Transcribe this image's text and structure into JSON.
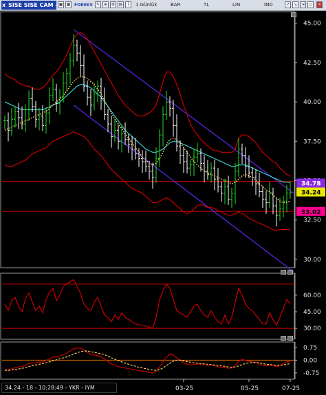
{
  "toolbar": {
    "symbol": "SISE SISE CAM -",
    "close_glyph": "x",
    "brand": "FOREKS",
    "period": "1 Günlük",
    "chart_type": "BAR",
    "currency": "TL",
    "scale": "LIN",
    "indicators": "IND"
  },
  "status_bar": {
    "text": "34.24 - 18 - 10:28:49 - YKR - IYM"
  },
  "colors": {
    "background": "#000000",
    "price_up": "#22dd22",
    "price_down": "#ffffff",
    "bollinger": "#cc0000",
    "moving_average": "#33cccc",
    "dotted_ma": "#ffcc66",
    "channel": "#5522cc",
    "level_line": "#cc0000",
    "label_high": "#8a2be2",
    "label_last": "#e8e800",
    "label_low": "#ff0090",
    "axis_text": "#e0e0e0"
  },
  "chart_data": [
    {
      "type": "line",
      "panel": "price",
      "yticks": [
        "45.00",
        "42.50",
        "40.00",
        "37.50",
        "35.00",
        "32.50",
        "30.00"
      ],
      "ylim": [
        29.6,
        45.6
      ],
      "xticks": [
        "03-25",
        "05-25",
        "07-25"
      ],
      "price_labels": {
        "high": "34.78",
        "last": "34.24",
        "low": "33.02"
      },
      "levels": [
        34.95,
        33.05
      ],
      "channel_lines": [
        {
          "x": [
            20,
            84
          ],
          "y": [
            44.6,
            34.2
          ]
        },
        {
          "x": [
            20,
            84
          ],
          "y": [
            39.8,
            29.2
          ]
        }
      ],
      "series": [
        {
          "key": "price",
          "close": [
            38.8,
            38.2,
            38.9,
            39.4,
            39.0,
            38.6,
            39.5,
            40.2,
            39.7,
            38.9,
            39.1,
            38.5,
            39.3,
            40.4,
            40.8,
            39.9,
            40.3,
            41.2,
            41.8,
            42.6,
            43.6,
            43.1,
            42.3,
            41.0,
            40.3,
            39.8,
            40.5,
            41.0,
            40.2,
            39.2,
            38.6,
            37.8,
            38.2,
            37.5,
            38.0,
            37.6,
            37.3,
            37.0,
            36.7,
            36.4,
            36.2,
            35.9,
            35.6,
            35.2,
            36.4,
            37.9,
            39.2,
            40.0,
            39.6,
            38.5,
            37.2,
            36.6,
            36.2,
            35.8,
            36.0,
            36.5,
            36.7,
            36.1,
            35.6,
            35.4,
            35.8,
            35.1,
            34.6,
            34.2,
            34.6,
            33.8,
            34.2,
            35.6,
            37.0,
            36.6,
            35.9,
            35.5,
            35.2,
            34.8,
            34.3,
            33.8,
            33.6,
            34.2,
            33.4,
            32.8,
            33.2,
            33.7,
            34.2,
            34.24
          ]
        },
        {
          "key": "bollinger_upper",
          "values": [
            41.8,
            41.6,
            41.5,
            41.4,
            41.2,
            41.1,
            41.0,
            41.0,
            40.9,
            40.8,
            40.8,
            40.9,
            41.1,
            41.4,
            41.7,
            41.9,
            42.2,
            42.6,
            43.0,
            43.5,
            44.0,
            44.3,
            44.4,
            44.3,
            44.0,
            43.6,
            43.2,
            42.8,
            42.4,
            42.0,
            41.6,
            41.2,
            40.8,
            40.4,
            40.1,
            39.8,
            39.6,
            39.4,
            39.2,
            39.1,
            39.1,
            39.2,
            39.3,
            39.5,
            39.8,
            40.5,
            41.3,
            41.9,
            41.9,
            41.6,
            41.1,
            40.5,
            39.8,
            39.2,
            38.6,
            38.2,
            37.9,
            37.6,
            37.4,
            37.2,
            37.0,
            36.9,
            36.9,
            36.8,
            36.8,
            36.8,
            36.8,
            37.0,
            37.7,
            37.9,
            37.9,
            37.8,
            37.6,
            37.4,
            37.1,
            36.8,
            36.6,
            36.4,
            36.2,
            36.1,
            35.8,
            35.6,
            35.4,
            35.3
          ]
        },
        {
          "key": "bollinger_lower",
          "values": [
            36.0,
            35.9,
            35.9,
            36.0,
            36.1,
            36.2,
            36.3,
            36.5,
            36.7,
            36.8,
            36.9,
            37.0,
            37.1,
            37.3,
            37.5,
            37.6,
            37.7,
            37.8,
            37.9,
            38.0,
            38.1,
            38.0,
            37.9,
            37.8,
            37.6,
            37.3,
            37.0,
            36.8,
            36.6,
            36.3,
            36.0,
            35.7,
            35.5,
            35.3,
            35.1,
            34.9,
            34.7,
            34.5,
            34.4,
            34.3,
            34.2,
            34.0,
            33.8,
            33.6,
            33.6,
            33.7,
            33.8,
            33.9,
            33.8,
            33.6,
            33.4,
            33.2,
            33.0,
            32.9,
            33.0,
            33.2,
            33.4,
            33.5,
            33.4,
            33.3,
            33.3,
            33.2,
            33.1,
            33.0,
            32.9,
            32.8,
            32.8,
            32.9,
            33.0,
            32.9,
            32.8,
            32.6,
            32.5,
            32.4,
            32.3,
            32.2,
            32.1,
            32.0,
            31.9,
            31.8,
            31.9,
            31.9,
            31.9,
            31.9
          ]
        },
        {
          "key": "ma_dotted",
          "values": [
            38.2,
            38.3,
            38.4,
            38.5,
            38.6,
            38.7,
            38.8,
            38.9,
            39.0,
            39.1,
            39.2,
            39.3,
            39.4,
            39.6,
            39.8,
            40.0,
            40.2,
            40.4,
            40.7,
            41.0,
            41.3,
            41.5,
            41.6,
            41.6,
            41.5,
            41.3,
            41.1,
            40.8,
            40.5,
            40.1,
            39.7,
            39.3,
            38.9,
            38.6,
            38.3,
            38.0,
            37.7,
            37.4,
            37.1,
            36.8,
            36.5,
            36.3,
            36.1,
            36.0,
            36.1,
            36.4,
            36.8,
            37.3,
            37.6,
            37.7,
            37.6,
            37.4,
            37.1,
            36.8,
            36.5,
            36.2,
            36.0,
            35.8,
            35.6,
            35.5,
            35.4,
            35.3,
            35.2,
            35.1,
            35.0,
            34.9,
            34.8,
            34.9,
            35.1,
            35.3,
            35.4,
            35.3,
            35.2,
            35.0,
            34.8,
            34.6,
            34.4,
            34.3,
            34.1,
            33.9,
            33.7,
            33.6,
            33.6,
            33.7
          ]
        },
        {
          "key": "ma_solid",
          "values": [
            40.0,
            39.9,
            39.8,
            39.7,
            39.6,
            39.5,
            39.5,
            39.5,
            39.5,
            39.5,
            39.5,
            39.5,
            39.6,
            39.7,
            39.8,
            39.9,
            40.0,
            40.2,
            40.4,
            40.6,
            40.8,
            41.0,
            41.1,
            41.1,
            41.0,
            40.9,
            40.7,
            40.5,
            40.3,
            40.0,
            39.7,
            39.4,
            39.1,
            38.8,
            38.5,
            38.2,
            38.0,
            37.8,
            37.6,
            37.4,
            37.2,
            37.0,
            36.9,
            36.8,
            36.8,
            36.9,
            37.0,
            37.2,
            37.4,
            37.5,
            37.5,
            37.4,
            37.3,
            37.2,
            37.1,
            37.0,
            36.9,
            36.8,
            36.7,
            36.6,
            36.5,
            36.4,
            36.3,
            36.2,
            36.1,
            36.0,
            35.9,
            35.9,
            36.0,
            36.0,
            36.0,
            35.9,
            35.8,
            35.7,
            35.6,
            35.5,
            35.4,
            35.3,
            35.2,
            35.1,
            35.0,
            34.9,
            34.9,
            34.9
          ]
        }
      ]
    },
    {
      "type": "line",
      "panel": "rsi",
      "yticks": [
        "60.00",
        "45.00",
        "30.00"
      ],
      "ylim": [
        22,
        78
      ],
      "levels": [
        70,
        30
      ],
      "series": [
        {
          "key": "rsi",
          "values": [
            52,
            46,
            55,
            58,
            50,
            45,
            57,
            62,
            54,
            46,
            50,
            44,
            56,
            63,
            66,
            55,
            60,
            68,
            70,
            72,
            74,
            68,
            62,
            52,
            48,
            46,
            54,
            58,
            50,
            42,
            40,
            36,
            42,
            38,
            44,
            40,
            38,
            36,
            34,
            33,
            33,
            32,
            31,
            30,
            40,
            56,
            64,
            70,
            66,
            56,
            46,
            44,
            42,
            40,
            45,
            50,
            52,
            46,
            42,
            40,
            46,
            40,
            36,
            34,
            42,
            34,
            40,
            54,
            66,
            60,
            52,
            48,
            46,
            42,
            38,
            34,
            34,
            44,
            38,
            33,
            40,
            48,
            56,
            52
          ]
        }
      ]
    },
    {
      "type": "line",
      "panel": "macd",
      "yticks": [
        "0.75",
        "0.00",
        "-0.75"
      ],
      "ylim": [
        -1.0,
        0.95
      ],
      "levels": [
        0.0
      ],
      "series": [
        {
          "key": "macd",
          "values": [
            -0.55,
            -0.58,
            -0.52,
            -0.44,
            -0.4,
            -0.38,
            -0.3,
            -0.2,
            -0.16,
            -0.16,
            -0.12,
            -0.1,
            -0.02,
            0.08,
            0.18,
            0.2,
            0.24,
            0.32,
            0.42,
            0.54,
            0.66,
            0.72,
            0.7,
            0.6,
            0.46,
            0.34,
            0.3,
            0.28,
            0.2,
            0.06,
            -0.08,
            -0.22,
            -0.3,
            -0.38,
            -0.42,
            -0.46,
            -0.5,
            -0.54,
            -0.58,
            -0.62,
            -0.64,
            -0.68,
            -0.72,
            -0.76,
            -0.66,
            -0.4,
            -0.1,
            0.2,
            0.34,
            0.3,
            0.14,
            -0.02,
            -0.14,
            -0.24,
            -0.28,
            -0.26,
            -0.22,
            -0.24,
            -0.28,
            -0.3,
            -0.28,
            -0.32,
            -0.38,
            -0.44,
            -0.42,
            -0.48,
            -0.46,
            -0.3,
            -0.06,
            0.04,
            0.0,
            -0.06,
            -0.1,
            -0.16,
            -0.22,
            -0.3,
            -0.34,
            -0.28,
            -0.32,
            -0.38,
            -0.32,
            -0.22,
            -0.1,
            -0.06
          ]
        },
        {
          "key": "signal",
          "values": [
            -0.6,
            -0.6,
            -0.58,
            -0.55,
            -0.52,
            -0.48,
            -0.44,
            -0.38,
            -0.32,
            -0.28,
            -0.24,
            -0.2,
            -0.16,
            -0.1,
            -0.04,
            0.02,
            0.08,
            0.14,
            0.2,
            0.28,
            0.36,
            0.44,
            0.5,
            0.54,
            0.54,
            0.5,
            0.46,
            0.42,
            0.38,
            0.32,
            0.24,
            0.14,
            0.06,
            -0.02,
            -0.1,
            -0.18,
            -0.24,
            -0.3,
            -0.36,
            -0.42,
            -0.46,
            -0.5,
            -0.54,
            -0.58,
            -0.6,
            -0.56,
            -0.46,
            -0.32,
            -0.18,
            -0.06,
            0.0,
            0.0,
            -0.04,
            -0.08,
            -0.12,
            -0.16,
            -0.18,
            -0.2,
            -0.22,
            -0.24,
            -0.26,
            -0.28,
            -0.3,
            -0.34,
            -0.36,
            -0.4,
            -0.42,
            -0.4,
            -0.34,
            -0.26,
            -0.2,
            -0.16,
            -0.14,
            -0.14,
            -0.16,
            -0.2,
            -0.24,
            -0.26,
            -0.28,
            -0.3,
            -0.3,
            -0.28,
            -0.24,
            -0.2
          ]
        }
      ]
    }
  ]
}
